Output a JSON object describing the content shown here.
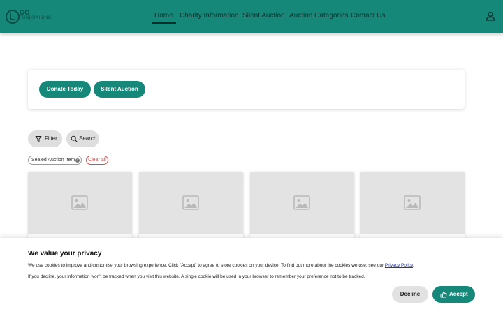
{
  "brand": {
    "logo_top": "GO",
    "logo_bottom": "FUNDRAISING",
    "primary_color": "#15887a"
  },
  "nav": {
    "items": [
      {
        "label": "Home",
        "active": true
      },
      {
        "label": "Charity Information",
        "active": false
      },
      {
        "label": "Silent Auction",
        "active": false
      },
      {
        "label": "Auction Categories",
        "active": false
      },
      {
        "label": "Contact Us",
        "active": false
      }
    ],
    "user_icon": "user-icon"
  },
  "actions": {
    "donate_label": "Donate Today",
    "silent_auction_label": "Silent Auction"
  },
  "toolbar": {
    "filter_label": "Filter",
    "search_label": "Search"
  },
  "active_filters": {
    "tags": [
      {
        "label": "Sealed Auction Item"
      }
    ],
    "clear_label": "Clear all"
  },
  "items": [
    {
      "image_icon": "image-placeholder-icon"
    },
    {
      "image_icon": "image-placeholder-icon"
    },
    {
      "image_icon": "image-placeholder-icon"
    },
    {
      "image_icon": "image-placeholder-icon"
    }
  ],
  "cookie": {
    "title": "We value your privacy",
    "text1": "We use cookies to improve and customise your browsing experience. Click \"Accept\" to agree to store cookies on your device. To find out more about the cookies we use, see our ",
    "policy_link": "Privacy Policy",
    "text1_end": ".",
    "text2": "If you decline, your information won't be tracked when you visit this website. A single cookie will be used in your browser to remember your preference not to be tracked.",
    "decline_label": "Decline",
    "accept_label": "Accept"
  }
}
